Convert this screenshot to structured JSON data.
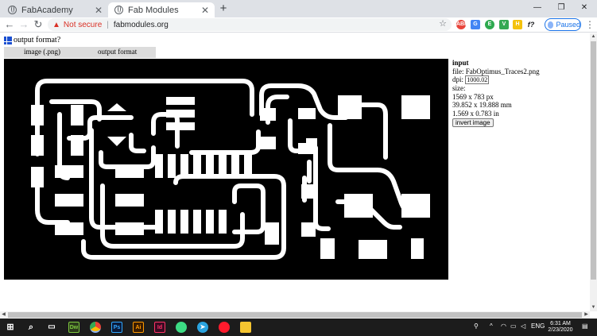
{
  "browser": {
    "tabs": [
      {
        "title": "FabAcademy",
        "close": "✕"
      },
      {
        "title": "Fab Modules",
        "close": "✕"
      }
    ],
    "new_tab": "+",
    "window_controls": {
      "minimize": "—",
      "restore": "❐",
      "close": "✕"
    },
    "nav": {
      "back": "←",
      "forward": "→",
      "reload": "↻"
    },
    "omnibox": {
      "security_text": "Not secure",
      "separator": "|",
      "url": "fabmodules.org",
      "warn_icon": "▲",
      "star_icon": "☆"
    },
    "profile": {
      "label": "Paused"
    },
    "menu": "⋮",
    "extensions": [
      "ABP",
      "G",
      "E",
      "V",
      "H",
      "f?"
    ]
  },
  "page": {
    "output_format_label": "output format?",
    "menubar": {
      "item1": "image (.png)",
      "item2": "output format"
    },
    "input_panel": {
      "heading": "input",
      "file": "file: FabOptimus_Traces2.png",
      "dpi_label": "dpi:",
      "dpi_value": "1000.02",
      "size_label": "size:",
      "size_px": "1569 x 783 px",
      "size_mm": "39.852 x 19.888 mm",
      "size_in": "1.569 x 0.783 in",
      "invert_label": "invert image"
    }
  },
  "taskbar": {
    "apps": [
      "Dw",
      "Ps",
      "Ai",
      "Id"
    ],
    "tray_lang": "ENG",
    "time": "6:31 AM",
    "date": "2/23/2020"
  },
  "colors": {
    "chrome_bg": "#dee1e6",
    "accent_blue": "#1a73e8",
    "warn_red": "#d93025",
    "dw_green": "#2b3a1b",
    "ps_blue": "#0a1a3a",
    "ai_orange": "#3a1c00",
    "id_pink": "#3a0a22"
  }
}
